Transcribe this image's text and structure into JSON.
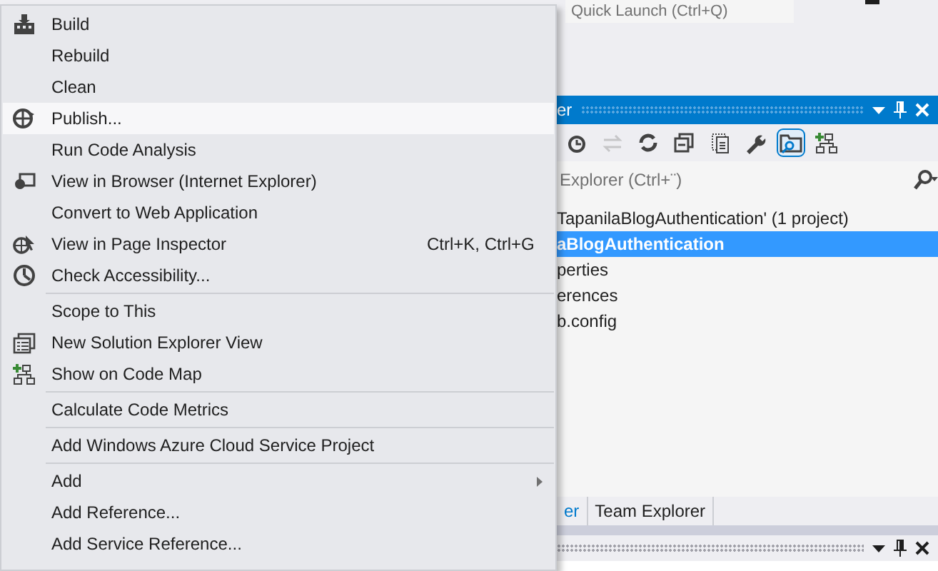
{
  "quick_launch": {
    "placeholder": "Quick Launch (Ctrl+Q)"
  },
  "context_menu": [
    {
      "kind": "item",
      "label": "Build",
      "selected": false,
      "submenu": false
    },
    {
      "kind": "item",
      "label": "Rebuild",
      "selected": false,
      "submenu": false
    },
    {
      "kind": "item",
      "label": "Clean",
      "selected": false,
      "submenu": false
    },
    {
      "kind": "item",
      "label": "Publish...",
      "selected": true,
      "submenu": false
    },
    {
      "kind": "item",
      "label": "Run Code Analysis",
      "selected": false,
      "submenu": false
    },
    {
      "kind": "item",
      "label": "View in Browser (Internet Explorer)",
      "selected": false,
      "submenu": false
    },
    {
      "kind": "item",
      "label": "Convert to Web Application",
      "selected": false,
      "submenu": false
    },
    {
      "kind": "item",
      "label": "View in Page Inspector",
      "shortcut": "Ctrl+K, Ctrl+G",
      "selected": false,
      "submenu": false
    },
    {
      "kind": "item",
      "label": "Check Accessibility...",
      "selected": false,
      "submenu": false
    },
    {
      "kind": "separator"
    },
    {
      "kind": "item",
      "label": "Scope to This",
      "selected": false,
      "submenu": false
    },
    {
      "kind": "item",
      "label": "New Solution Explorer View",
      "selected": false,
      "submenu": false
    },
    {
      "kind": "item",
      "label": "Show on Code Map",
      "selected": false,
      "submenu": false
    },
    {
      "kind": "separator"
    },
    {
      "kind": "item",
      "label": "Calculate Code Metrics",
      "selected": false,
      "submenu": false
    },
    {
      "kind": "separator"
    },
    {
      "kind": "item",
      "label": "Add Windows Azure Cloud Service Project",
      "selected": false,
      "submenu": false
    },
    {
      "kind": "separator"
    },
    {
      "kind": "item",
      "label": "Add",
      "selected": false,
      "submenu": true
    },
    {
      "kind": "item",
      "label": "Add Reference...",
      "selected": false,
      "submenu": false
    },
    {
      "kind": "item",
      "label": "Add Service Reference...",
      "selected": false,
      "submenu": false
    }
  ],
  "solution_explorer": {
    "title": "er",
    "toolbar": [
      {
        "selected": false,
        "disabled": false
      },
      {
        "selected": false,
        "disabled": true
      },
      {
        "selected": false,
        "disabled": false
      },
      {
        "selected": false,
        "disabled": false
      },
      {
        "selected": false,
        "disabled": false
      },
      {
        "selected": false,
        "disabled": false
      },
      {
        "selected": true,
        "disabled": false
      },
      {
        "selected": false,
        "disabled": false
      }
    ],
    "search": {
      "placeholder": "Explorer (Ctrl+¨)"
    },
    "tree": [
      {
        "label": "TapanilaBlogAuthentication' (1 project)",
        "selected": false,
        "children": [
          {
            "label": "aBlogAuthentication",
            "selected": true,
            "children": [
              {
                "label": "perties",
                "selected": false
              },
              {
                "label": "erences",
                "selected": false
              },
              {
                "label": "b.config",
                "selected": false
              }
            ]
          }
        ]
      }
    ],
    "tabs": [
      {
        "label": "er",
        "selected": true
      },
      {
        "label": "Team Explorer",
        "selected": false
      }
    ]
  }
}
